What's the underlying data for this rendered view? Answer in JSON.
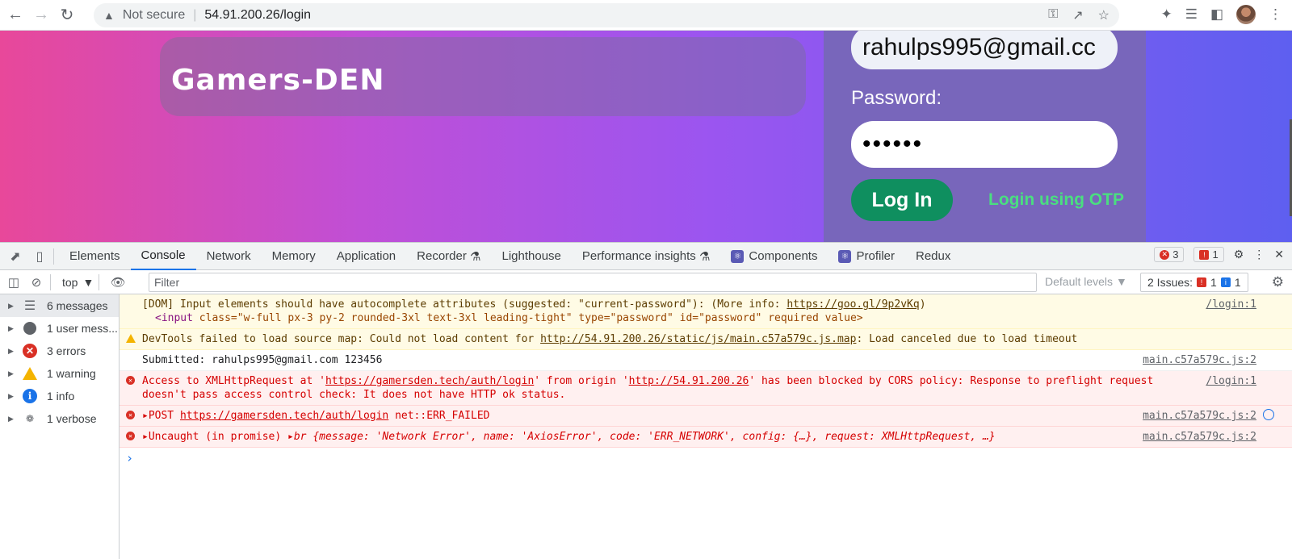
{
  "browser": {
    "security_label": "Not secure",
    "url": "54.91.200.26/login"
  },
  "page": {
    "brand": "Gamers-DEN",
    "email_value": "rahulps995@gmail.cc",
    "password_label": "Password:",
    "password_value": "••••••",
    "login_button": "Log In",
    "otp_link": "Login using OTP"
  },
  "devtools": {
    "tabs": [
      "Elements",
      "Console",
      "Network",
      "Memory",
      "Application",
      "Recorder",
      "Lighthouse",
      "Performance insights",
      "Components",
      "Profiler",
      "Redux"
    ],
    "error_count": "3",
    "issue_count": "1",
    "context": "top",
    "filter_placeholder": "Filter",
    "default_levels": "Default levels",
    "issues_label": "2 Issues:",
    "issues_err": "1",
    "issues_info": "1",
    "sidebar": [
      {
        "label": "6 messages"
      },
      {
        "label": "1 user mess..."
      },
      {
        "label": "3 errors"
      },
      {
        "label": "1 warning"
      },
      {
        "label": "1 info"
      },
      {
        "label": "1 verbose"
      }
    ],
    "messages": {
      "dom_text": "[DOM] Input elements should have autocomplete attributes (suggested: \"current-password\"): (More info: ",
      "dom_link": "https://goo.gl/9p2vKq",
      "dom_close": ")",
      "dom_src": "/login:1",
      "dom_code_tag": "<input ",
      "dom_code_attrs": "class=\"w-full px-3 py-2 rounded-3xl text-3xl leading-tight\" type=\"password\" id=\"password\" required value>",
      "warn_text": "DevTools failed to load source map: Could not load content for ",
      "warn_link": "http://54.91.200.26/static/js/main.c57a579c.js.map",
      "warn_tail": ": Load canceled due to load timeout",
      "log_text": "Submitted: rahulps995@gmail.com 123456",
      "log_src": "main.c57a579c.js:2",
      "cors_a": "Access to XMLHttpRequest at '",
      "cors_link1": "https://gamersden.tech/auth/login",
      "cors_b": "' from origin '",
      "cors_link2": "http://54.91.200.26",
      "cors_c": "' has been blocked by CORS policy: Response to preflight request",
      "cors_line2": "doesn't pass access control check: It does not have HTTP ok status.",
      "cors_src": "/login:1",
      "post_method": "POST ",
      "post_link": "https://gamersden.tech/auth/login",
      "post_tail": " net::ERR_FAILED",
      "post_src": "main.c57a579c.js:2",
      "uncaught_head": "Uncaught (in promise) ",
      "uncaught_obj": "br {message: 'Network Error', name: 'AxiosError', code: 'ERR_NETWORK', config: {…}, request: XMLHttpRequest, …}",
      "uncaught_src": "main.c57a579c.js:2"
    }
  }
}
